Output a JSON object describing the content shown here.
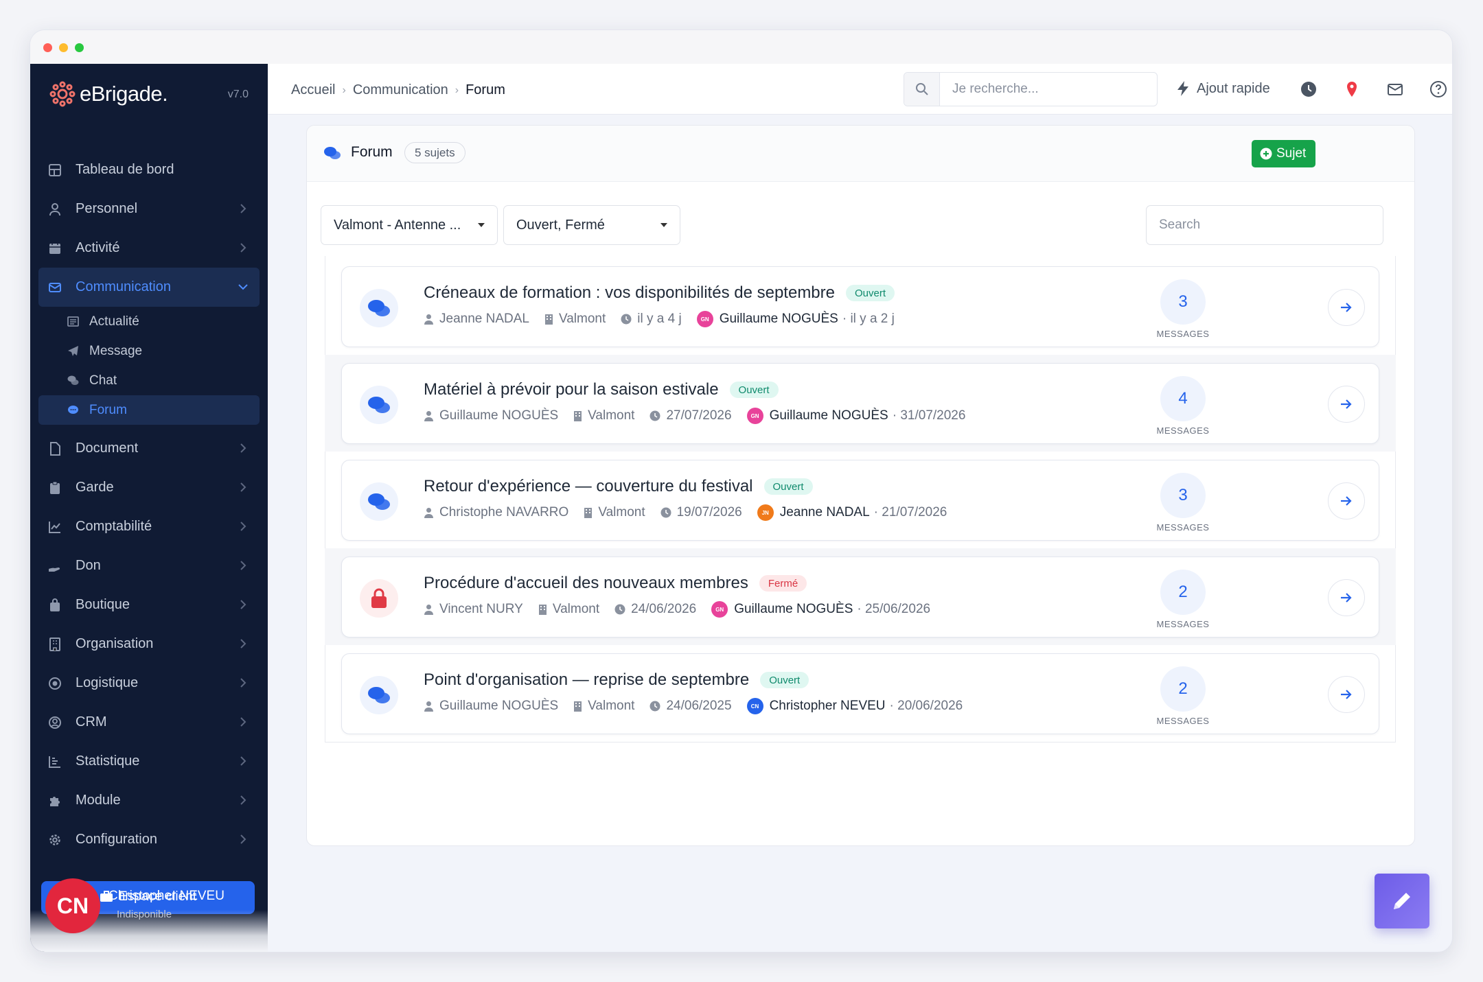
{
  "app": {
    "brand": "eBrigade.",
    "version": "v7.0"
  },
  "colors": {
    "sidebar_bg": "#101b34",
    "accent": "#2563eb",
    "success": "#16a34a",
    "open_badge": "#0f8a6c",
    "closed_badge": "#d93544"
  },
  "sidebar": {
    "items": [
      {
        "label": "Tableau de bord",
        "icon": "dashboard-icon"
      },
      {
        "label": "Personnel",
        "icon": "user-icon"
      },
      {
        "label": "Activité",
        "icon": "calendar-icon"
      },
      {
        "label": "Communication",
        "icon": "envelope-icon",
        "active": true
      },
      {
        "label": "Document",
        "icon": "file-icon"
      },
      {
        "label": "Garde",
        "icon": "clipboard-icon"
      },
      {
        "label": "Comptabilité",
        "icon": "chart-line-icon"
      },
      {
        "label": "Don",
        "icon": "hand-icon"
      },
      {
        "label": "Boutique",
        "icon": "shopping-bag-icon"
      },
      {
        "label": "Organisation",
        "icon": "building-icon"
      },
      {
        "label": "Logistique",
        "icon": "target-icon"
      },
      {
        "label": "CRM",
        "icon": "user-circle-icon"
      },
      {
        "label": "Statistique",
        "icon": "bar-list-icon"
      },
      {
        "label": "Module",
        "icon": "puzzle-icon"
      },
      {
        "label": "Configuration",
        "icon": "gear-icon"
      }
    ],
    "subitems": [
      {
        "label": "Actualité",
        "icon": "newspaper-icon"
      },
      {
        "label": "Message",
        "icon": "paper-plane-icon"
      },
      {
        "label": "Chat",
        "icon": "comments-icon"
      },
      {
        "label": "Forum",
        "icon": "comment-dots-icon",
        "active": true
      }
    ],
    "client_button": "Espace client",
    "profile": {
      "initials": "CN",
      "name": "Christopher NEVEU",
      "status": "Indisponible"
    }
  },
  "topbar": {
    "breadcrumb": [
      "Accueil",
      "Communication",
      "Forum"
    ],
    "search_placeholder": "Je recherche...",
    "quick_add": "Ajout rapide"
  },
  "forum": {
    "title": "Forum",
    "count": "5 sujets",
    "new_button": "Sujet",
    "filter_structure": "Valmont - Antenne ...",
    "filter_status": "Ouvert, Fermé",
    "search_placeholder": "Search",
    "messages_label": "MESSAGES",
    "topics": [
      {
        "title": "Créneaux de formation : vos disponibilités de septembre",
        "status": "Ouvert",
        "closed": false,
        "author": "Jeanne NADAL",
        "place": "Valmont",
        "created": "il y a 4 j",
        "last_initials": "GN",
        "last_color": "#e8439a",
        "last_author": "Guillaume NOGUÈS",
        "last_date": "· il y a 2 j",
        "messages": "3"
      },
      {
        "title": "Matériel à prévoir pour la saison estivale",
        "status": "Ouvert",
        "closed": false,
        "author": "Guillaume NOGUÈS",
        "place": "Valmont",
        "created": "27/07/2026",
        "last_initials": "GN",
        "last_color": "#e8439a",
        "last_author": "Guillaume NOGUÈS",
        "last_date": "· 31/07/2026",
        "messages": "4"
      },
      {
        "title": "Retour d'expérience — couverture du festival",
        "status": "Ouvert",
        "closed": false,
        "author": "Christophe NAVARRO",
        "place": "Valmont",
        "created": "19/07/2026",
        "last_initials": "JN",
        "last_color": "#f07a1a",
        "last_author": "Jeanne NADAL",
        "last_date": "· 21/07/2026",
        "messages": "3"
      },
      {
        "title": "Procédure d'accueil des nouveaux membres",
        "status": "Fermé",
        "closed": true,
        "author": "Vincent NURY",
        "place": "Valmont",
        "created": "24/06/2026",
        "last_initials": "GN",
        "last_color": "#e8439a",
        "last_author": "Guillaume NOGUÈS",
        "last_date": "· 25/06/2026",
        "messages": "2"
      },
      {
        "title": "Point d'organisation — reprise de septembre",
        "status": "Ouvert",
        "closed": false,
        "author": "Guillaume NOGUÈS",
        "place": "Valmont",
        "created": "24/06/2025",
        "last_initials": "CN",
        "last_color": "#2563eb",
        "last_author": "Christopher NEVEU",
        "last_date": "· 20/06/2026",
        "messages": "2"
      }
    ]
  }
}
